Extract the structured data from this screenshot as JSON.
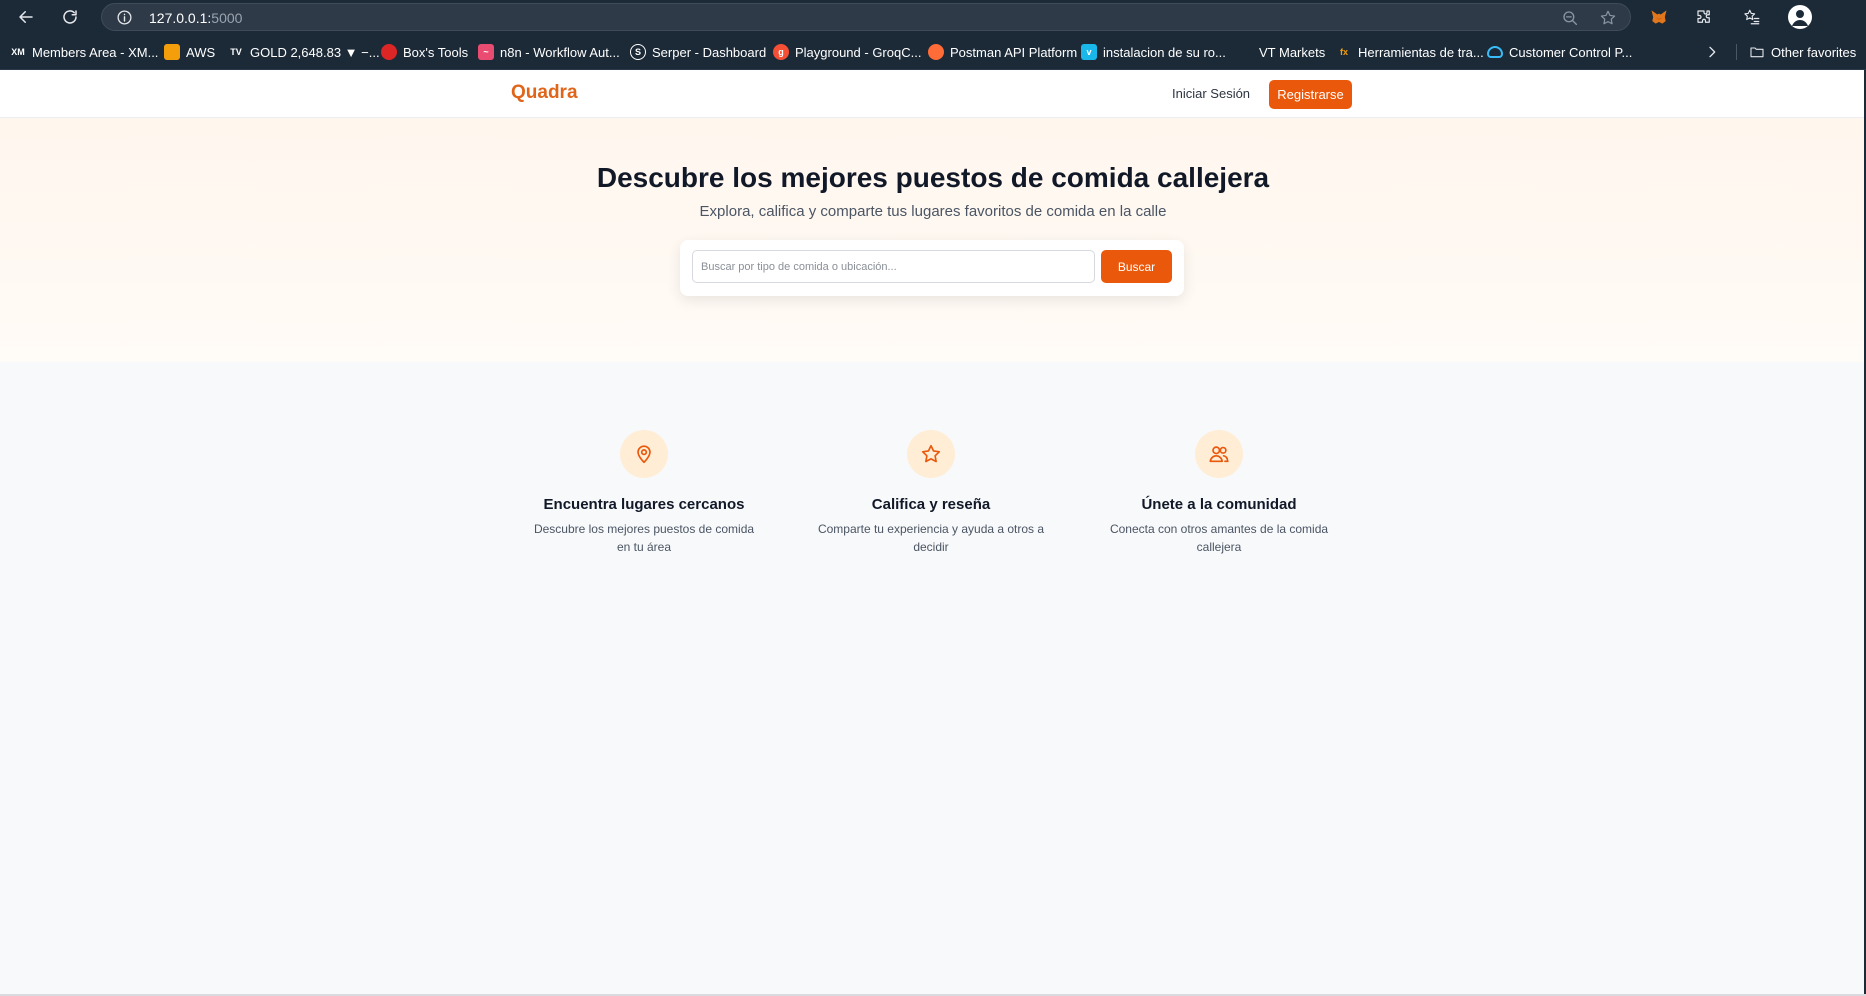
{
  "browser": {
    "url_host": "127.0.0.1:",
    "url_port": "5000",
    "bookmarks": [
      {
        "label": "Members Area - XM...",
        "icon": "xm-icon",
        "color": "#ffffff"
      },
      {
        "label": "AWS",
        "icon": "aws-icon",
        "color": "#f59e0b"
      },
      {
        "label": "GOLD 2,648.83 ▼ −...",
        "icon": "tradingview-icon",
        "color": "#ffffff"
      },
      {
        "label": "Box's Tools",
        "icon": "globe-icon",
        "color": "#dc2626"
      },
      {
        "label": "n8n - Workflow Aut...",
        "icon": "n8n-icon",
        "color": "#ea4b71"
      },
      {
        "label": "Serper - Dashboard",
        "icon": "serper-icon",
        "color": "#ffffff"
      },
      {
        "label": "Playground - GroqC...",
        "icon": "groq-icon",
        "color": "#f55036"
      },
      {
        "label": "Postman API Platform",
        "icon": "postman-icon",
        "color": "#ff6c37"
      },
      {
        "label": "instalacion de su ro...",
        "icon": "vimeo-icon",
        "color": "#1ab7ea"
      },
      {
        "label": "VT Markets",
        "icon": "vt-icon",
        "color": "#1e88e5"
      },
      {
        "label": "Herramientas de tra...",
        "icon": "fx-icon",
        "color": "#f59e0b"
      },
      {
        "label": "Customer Control P...",
        "icon": "cloud-icon",
        "color": "#38bdf8"
      }
    ],
    "other_favorites": "Other favorites"
  },
  "site": {
    "logo": "Quadra",
    "login": "Iniciar Sesión",
    "register": "Registrarse"
  },
  "hero": {
    "title": "Descubre los mejores puestos de comida callejera",
    "subtitle": "Explora, califica y comparte tus lugares favoritos de comida en la calle",
    "search_placeholder": "Buscar por tipo de comida o ubicación...",
    "search_button": "Buscar"
  },
  "features": [
    {
      "icon": "map-pin-icon",
      "title": "Encuentra lugares cercanos",
      "desc": "Descubre los mejores puestos de comida en tu área"
    },
    {
      "icon": "star-icon",
      "title": "Califica y reseña",
      "desc": "Comparte tu experiencia y ayuda a otros a decidir"
    },
    {
      "icon": "users-icon",
      "title": "Únete a la comunidad",
      "desc": "Conecta con otros amantes de la comida callejera"
    }
  ],
  "colors": {
    "accent": "#ea580c",
    "logo": "#e0651a",
    "icon_bg": "#ffedd5",
    "chrome": "#1c2a38"
  }
}
